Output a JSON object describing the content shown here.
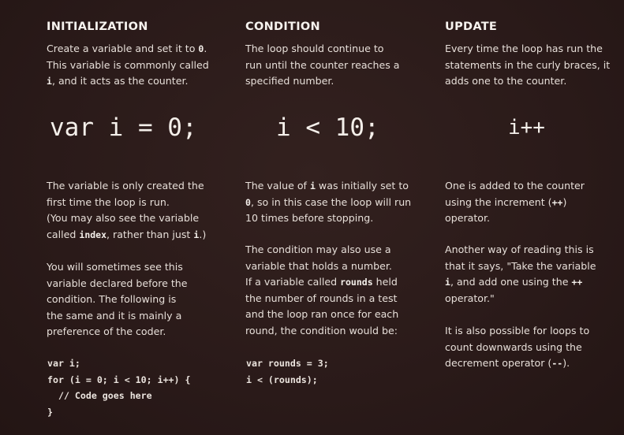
{
  "initialization": {
    "heading": "INITIALIZATION",
    "intro": [
      {
        "t": "Create a variable and set it to "
      },
      {
        "c": "0"
      },
      {
        "t": "."
      },
      {
        "br": true
      },
      {
        "t": "This variable is commonly called"
      },
      {
        "br": true
      },
      {
        "c": "i"
      },
      {
        "t": ", and it acts as the counter."
      }
    ],
    "code": "var i = 0;",
    "para1": [
      {
        "t": "The variable is only created the"
      },
      {
        "br": true
      },
      {
        "t": "first time the loop is run."
      },
      {
        "br": true
      },
      {
        "t": "(You may also see the variable"
      },
      {
        "br": true
      },
      {
        "t": "called "
      },
      {
        "c": "index"
      },
      {
        "t": ", rather than just "
      },
      {
        "c": "i"
      },
      {
        "t": ".)"
      }
    ],
    "para2": [
      {
        "t": "You will sometimes see this"
      },
      {
        "br": true
      },
      {
        "t": "variable declared before the"
      },
      {
        "br": true
      },
      {
        "t": "condition. The following is"
      },
      {
        "br": true
      },
      {
        "t": "the same and it is mainly a"
      },
      {
        "br": true
      },
      {
        "t": "preference of the coder."
      }
    ],
    "code_example": "var i;\nfor (i = 0; i < 10; i++) {\n  // Code goes here\n}"
  },
  "condition": {
    "heading": "CONDITION",
    "intro": [
      {
        "t": "The loop should continue to"
      },
      {
        "br": true
      },
      {
        "t": "run until the counter reaches a"
      },
      {
        "br": true
      },
      {
        "t": "specified number."
      }
    ],
    "code": "i < 10;",
    "para1": [
      {
        "t": "The value of "
      },
      {
        "c": "i"
      },
      {
        "t": " was initially set to"
      },
      {
        "br": true
      },
      {
        "c": "0"
      },
      {
        "t": ", so in this case the loop will run"
      },
      {
        "br": true
      },
      {
        "t": "10 times before stopping."
      }
    ],
    "para2": [
      {
        "t": "The condition may also use a"
      },
      {
        "br": true
      },
      {
        "t": "variable that holds a number."
      },
      {
        "br": true
      },
      {
        "t": "If a variable called "
      },
      {
        "c": "rounds"
      },
      {
        "t": " held"
      },
      {
        "br": true
      },
      {
        "t": "the number of rounds in a test"
      },
      {
        "br": true
      },
      {
        "t": "and the loop ran once for each"
      },
      {
        "br": true
      },
      {
        "t": "round, the condition would be:"
      }
    ],
    "code_example": "var rounds = 3;\ni < (rounds);"
  },
  "update": {
    "heading": "UPDATE",
    "intro": [
      {
        "t": "Every time the loop has run the"
      },
      {
        "br": true
      },
      {
        "t": "statements in the curly braces, it"
      },
      {
        "br": true
      },
      {
        "t": "adds one to the counter."
      }
    ],
    "code": "i++",
    "para1": [
      {
        "t": "One is added to the counter"
      },
      {
        "br": true
      },
      {
        "t": "using the increment ("
      },
      {
        "c": "++"
      },
      {
        "t": ")"
      },
      {
        "br": true
      },
      {
        "t": "operator."
      }
    ],
    "para2": [
      {
        "t": "Another way of reading this is"
      },
      {
        "br": true
      },
      {
        "t": "that it says, \"Take the variable"
      },
      {
        "br": true
      },
      {
        "c": "i"
      },
      {
        "t": ", and add one using the "
      },
      {
        "c": "++"
      },
      {
        "br": true
      },
      {
        "t": "operator.\""
      }
    ],
    "para3": [
      {
        "t": "It is also possible for loops to"
      },
      {
        "br": true
      },
      {
        "t": "count downwards using the"
      },
      {
        "br": true
      },
      {
        "t": "decrement operator ("
      },
      {
        "c": "--"
      },
      {
        "t": ")."
      }
    ]
  }
}
